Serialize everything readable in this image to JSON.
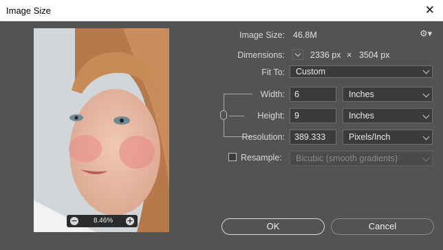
{
  "window": {
    "title": "Image Size",
    "close_symbol": "✕"
  },
  "preview": {
    "zoom_value": "8.46%",
    "zoom_out_symbol": "−",
    "zoom_in_symbol": "+"
  },
  "info": {
    "image_size_label": "Image Size:",
    "image_size_value": "46.8M",
    "dimensions_label": "Dimensions:",
    "dimensions_width": "2336 px",
    "dimensions_times": "×",
    "dimensions_height": "3504 px"
  },
  "fit_to": {
    "label": "Fit To:",
    "value": "Custom"
  },
  "width": {
    "label": "Width:",
    "value": "6",
    "unit": "Inches"
  },
  "height": {
    "label": "Height:",
    "value": "9",
    "unit": "Inches"
  },
  "resolution": {
    "label": "Resolution:",
    "value": "389.333",
    "unit": "Pixels/Inch"
  },
  "resample": {
    "label": "Resample:",
    "checked": false,
    "value": "Bicubic (smooth gradients)"
  },
  "buttons": {
    "ok": "OK",
    "cancel": "Cancel"
  }
}
